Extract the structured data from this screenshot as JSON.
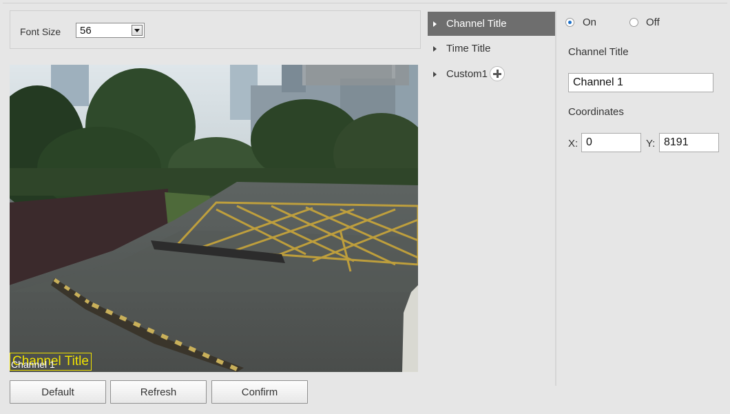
{
  "font_size": {
    "label": "Font Size",
    "value": "56"
  },
  "preview": {
    "osd_title": "Channel Title",
    "osd_channel": "Channel 1"
  },
  "buttons": {
    "default": "Default",
    "refresh": "Refresh",
    "confirm": "Confirm"
  },
  "tree": {
    "items": [
      {
        "label": "Channel Title",
        "active": true
      },
      {
        "label": "Time Title",
        "active": false
      },
      {
        "label": "Custom1",
        "active": false,
        "icon": "plus-circle-icon"
      }
    ]
  },
  "settings": {
    "on_label": "On",
    "off_label": "Off",
    "selected": "On",
    "channel_title_label": "Channel Title",
    "channel_title_value": "Channel 1",
    "coordinates_label": "Coordinates",
    "x_label": "X:",
    "x_value": "0",
    "y_label": "Y:",
    "y_value": "8191"
  },
  "colors": {
    "osd": "#f1e300",
    "active_tree_bg": "#6e6e6e",
    "radio_accent": "#1b6fc8"
  }
}
